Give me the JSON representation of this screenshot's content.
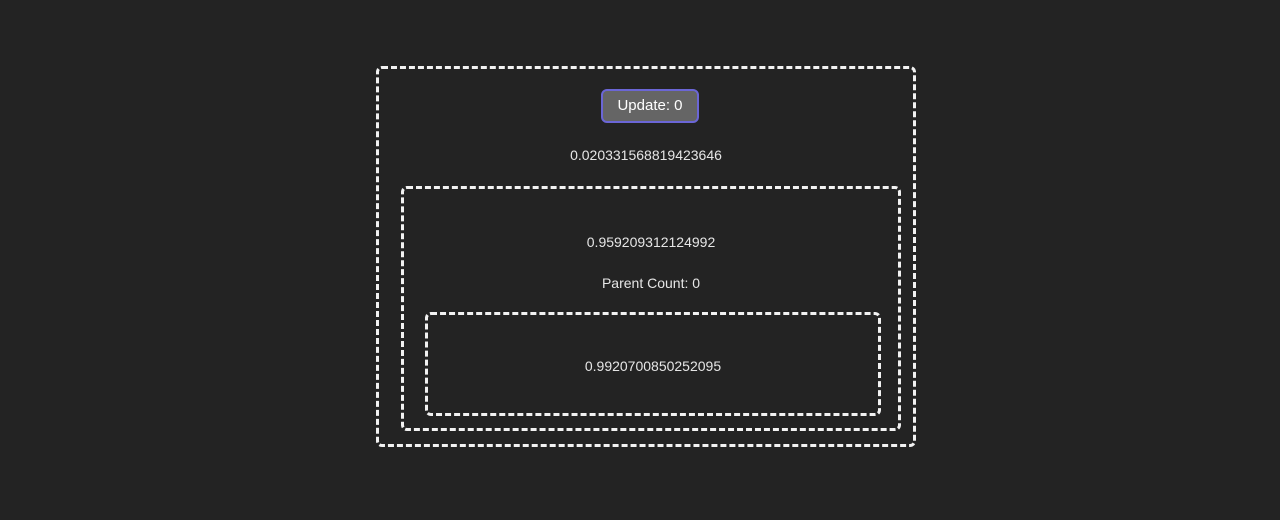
{
  "outer": {
    "button_label": "Update: 0",
    "value": "0.020331568819423646"
  },
  "middle": {
    "value": "0.959209312124992",
    "parent_count_label": "Parent Count: 0"
  },
  "inner": {
    "value": "0.9920700850252095"
  },
  "colors": {
    "background": "#232323",
    "dashed_border": "#f2f2f2",
    "button_bg": "#656565",
    "button_border": "#6b66d6"
  }
}
